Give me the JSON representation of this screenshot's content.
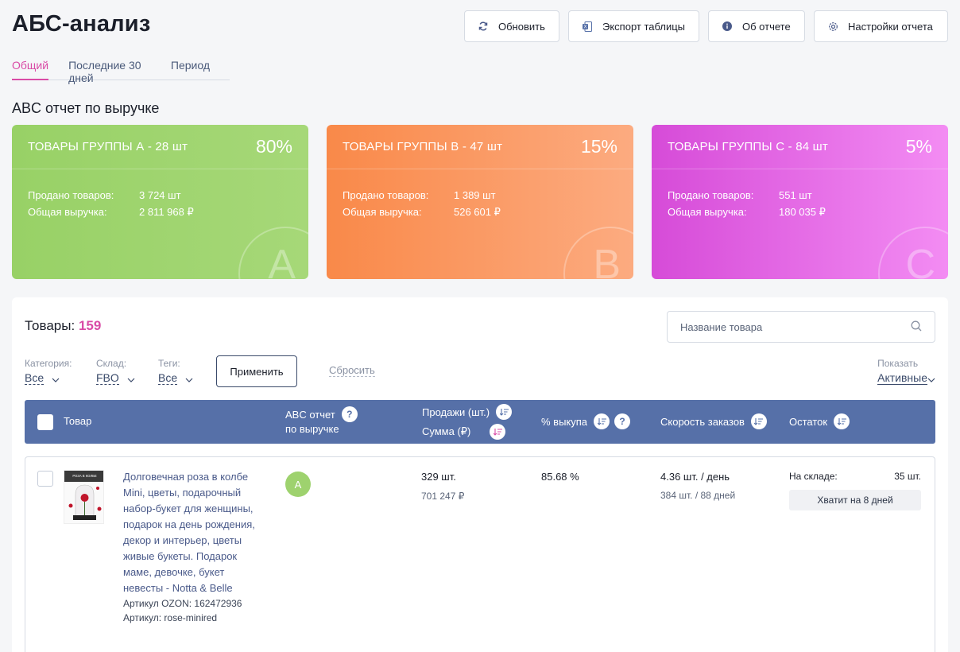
{
  "header": {
    "title": "АБС-анализ",
    "buttons": {
      "refresh": "Обновить",
      "export": "Экспорт таблицы",
      "about": "Об отчете",
      "settings": "Настройки отчета"
    }
  },
  "tabs": [
    {
      "label": "Общий",
      "active": true
    },
    {
      "label": "Последние 30 дней",
      "active": false
    },
    {
      "label": "Период",
      "active": false
    }
  ],
  "section_title": "ABC отчет по выручке",
  "cards": [
    {
      "name": "ТОВАРЫ ГРУППЫ А - 28 шт",
      "percent": "80%",
      "sold_label": "Продано товаров:",
      "sold": "3 724 шт",
      "revenue_label": "Общая выручка:",
      "revenue": "2 811 968 ₽",
      "letter": "A",
      "color": "#98d166"
    },
    {
      "name": "ТОВАРЫ ГРУППЫ В - 47 шт",
      "percent": "15%",
      "sold_label": "Продано товаров:",
      "sold": "1 389 шт",
      "revenue_label": "Общая выручка:",
      "revenue": "526 601 ₽",
      "letter": "B",
      "color": "#f98949"
    },
    {
      "name": "ТОВАРЫ ГРУППЫ С - 84 шт",
      "percent": "5%",
      "sold_label": "Продано товаров:",
      "sold": "551 шт",
      "revenue_label": "Общая выручка:",
      "revenue": "180 035 ₽",
      "letter": "C",
      "color": "#d64bd8"
    }
  ],
  "goods": {
    "label": "Товары:",
    "count": "159",
    "search_placeholder": "Название товара"
  },
  "filters": {
    "category_label": "Категория:",
    "category_value": "Все",
    "warehouse_label": "Склад:",
    "warehouse_value": "FBO",
    "tags_label": "Теги:",
    "tags_value": "Все",
    "apply": "Применить",
    "reset": "Сбросить",
    "show_label": "Показать",
    "show_value": "Активные"
  },
  "table": {
    "headers": {
      "product": "Товар",
      "abc_line1": "ABC отчет",
      "abc_line2": "по выручке",
      "sales_line1": "Продажи (шт.)",
      "sales_line2": "Сумма (₽)",
      "buyout": "% выкупа",
      "speed": "Скорость заказов",
      "stock": "Остаток"
    },
    "rows": [
      {
        "name": "Долговечная роза в колбе Mini, цветы, подарочный набор-букет для женщины, подарок на день рождения, декор и интерьер, цветы живые букеты. Подарок маме, девочке, букет невесты - Notta & Belle",
        "article_ozon": "Артикул OZON: 162472936",
        "article": "Артикул: rose-minired",
        "thumb_caption": "РОЗА В КОЛБЕ",
        "abc": "A",
        "sales_qty": "329 шт.",
        "sales_sum": "701 247 ₽",
        "buyout": "85.68 %",
        "speed": "4.36 шт. / день",
        "speed_detail": "384 шт. / 88 дней",
        "stock_label": "На складе:",
        "stock_value": "35 шт.",
        "stock_enough": "Хватит на 8 дней"
      }
    ]
  }
}
